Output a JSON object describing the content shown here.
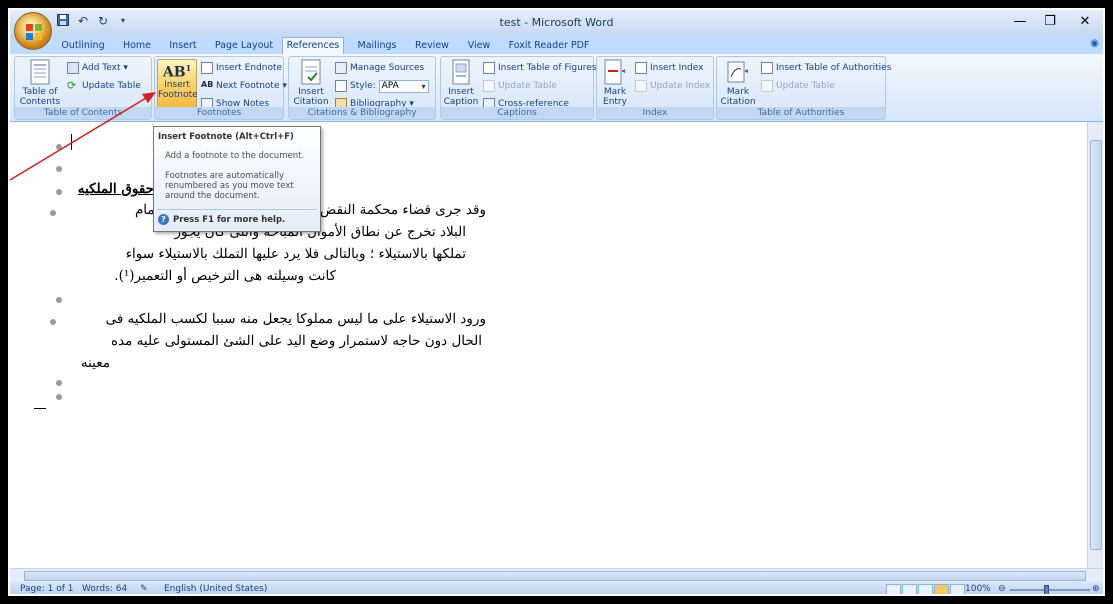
{
  "window": {
    "title": "test - Microsoft Word",
    "controls": [
      "minimize-icon",
      "restore-icon",
      "close-icon"
    ]
  },
  "quick_access": [
    "save-icon",
    "undo-icon",
    "redo-icon",
    "customize-icon"
  ],
  "tabs": [
    {
      "label": "Outlining"
    },
    {
      "label": "Home"
    },
    {
      "label": "Insert"
    },
    {
      "label": "Page Layout"
    },
    {
      "label": "References",
      "active": true
    },
    {
      "label": "Mailings"
    },
    {
      "label": "Review"
    },
    {
      "label": "View"
    },
    {
      "label": "Foxit Reader PDF"
    }
  ],
  "ribbon": {
    "toc": {
      "group_label": "Table of Contents",
      "table_of_contents_line1": "Table of",
      "table_of_contents_line2": "Contents ▾",
      "add_text": "Add Text ▾",
      "update_table": "Update Table"
    },
    "footnotes": {
      "group_label": "Footnotes",
      "insert_footnote_line1": "Insert",
      "insert_footnote_line2": "Footnote",
      "insert_endnote": "Insert Endnote",
      "next_footnote": "Next Footnote ▾",
      "show_notes": "Show Notes"
    },
    "citations": {
      "group_label": "Citations & Bibliography",
      "insert_citation_line1": "Insert",
      "insert_citation_line2": "Citation ▾",
      "manage_sources": "Manage Sources",
      "style_label": "Style:",
      "style_value": "APA",
      "bibliography": "Bibliography ▾"
    },
    "captions": {
      "group_label": "Captions",
      "insert_caption_line1": "Insert",
      "insert_caption_line2": "Caption",
      "insert_table_of_figures": "Insert Table of Figures",
      "update_table": "Update Table",
      "cross_reference": "Cross-reference"
    },
    "index": {
      "group_label": "Index",
      "mark_entry_line1": "Mark",
      "mark_entry_line2": "Entry",
      "insert_index": "Insert Index",
      "update_index": "Update Index"
    },
    "authorities": {
      "group_label": "Table of Authorities",
      "mark_citation_line1": "Mark",
      "mark_citation_line2": "Citation",
      "insert_table_of_authorities": "Insert Table of Authorities",
      "update_table": "Update Table"
    }
  },
  "tooltip": {
    "title": "Insert Footnote (Alt+Ctrl+F)",
    "description": "Add a footnote to the document.",
    "note_line1": "Footnotes are automatically",
    "note_line2": "renumbered as you move text",
    "note_line3": "around the document.",
    "help": "Press F1 for more help."
  },
  "document": {
    "heading": "حقوق الملكيه",
    "para1_line1": "وقد جرى قضاء محكمة النقض على ان الأموال الداخله فى زمام",
    "para1_line2": "البلاد تخرج عن نطاق الأموال المباحه والتى كان يجوز",
    "para1_line3": "تملكها بالاستيلاء ؛ وبالتالى فلا يرد عليها التملك بالاستيلاء سواء",
    "para1_line4": "كانت وسيلته هى الترخيص أو التعمير(¹).",
    "para2_line1": "ورود الاستيلاء على ما ليس مملوكا يجعل منه سببا لكسب الملكيه فى",
    "para2_line2": "الحال دون حاجه لاستمرار وضع اليد على الشئ المستولى عليه مده",
    "para2_line3": "معينه"
  },
  "status": {
    "page": "Page: 1 of 1",
    "words": "Words: 64",
    "language": "English (United States)",
    "zoom": "100%"
  },
  "colors": {
    "ribbon_bg": "#d6e6fa",
    "tab_text": "#15428b",
    "arrow": "#d21f1f",
    "highlight": "#f6b93b"
  }
}
